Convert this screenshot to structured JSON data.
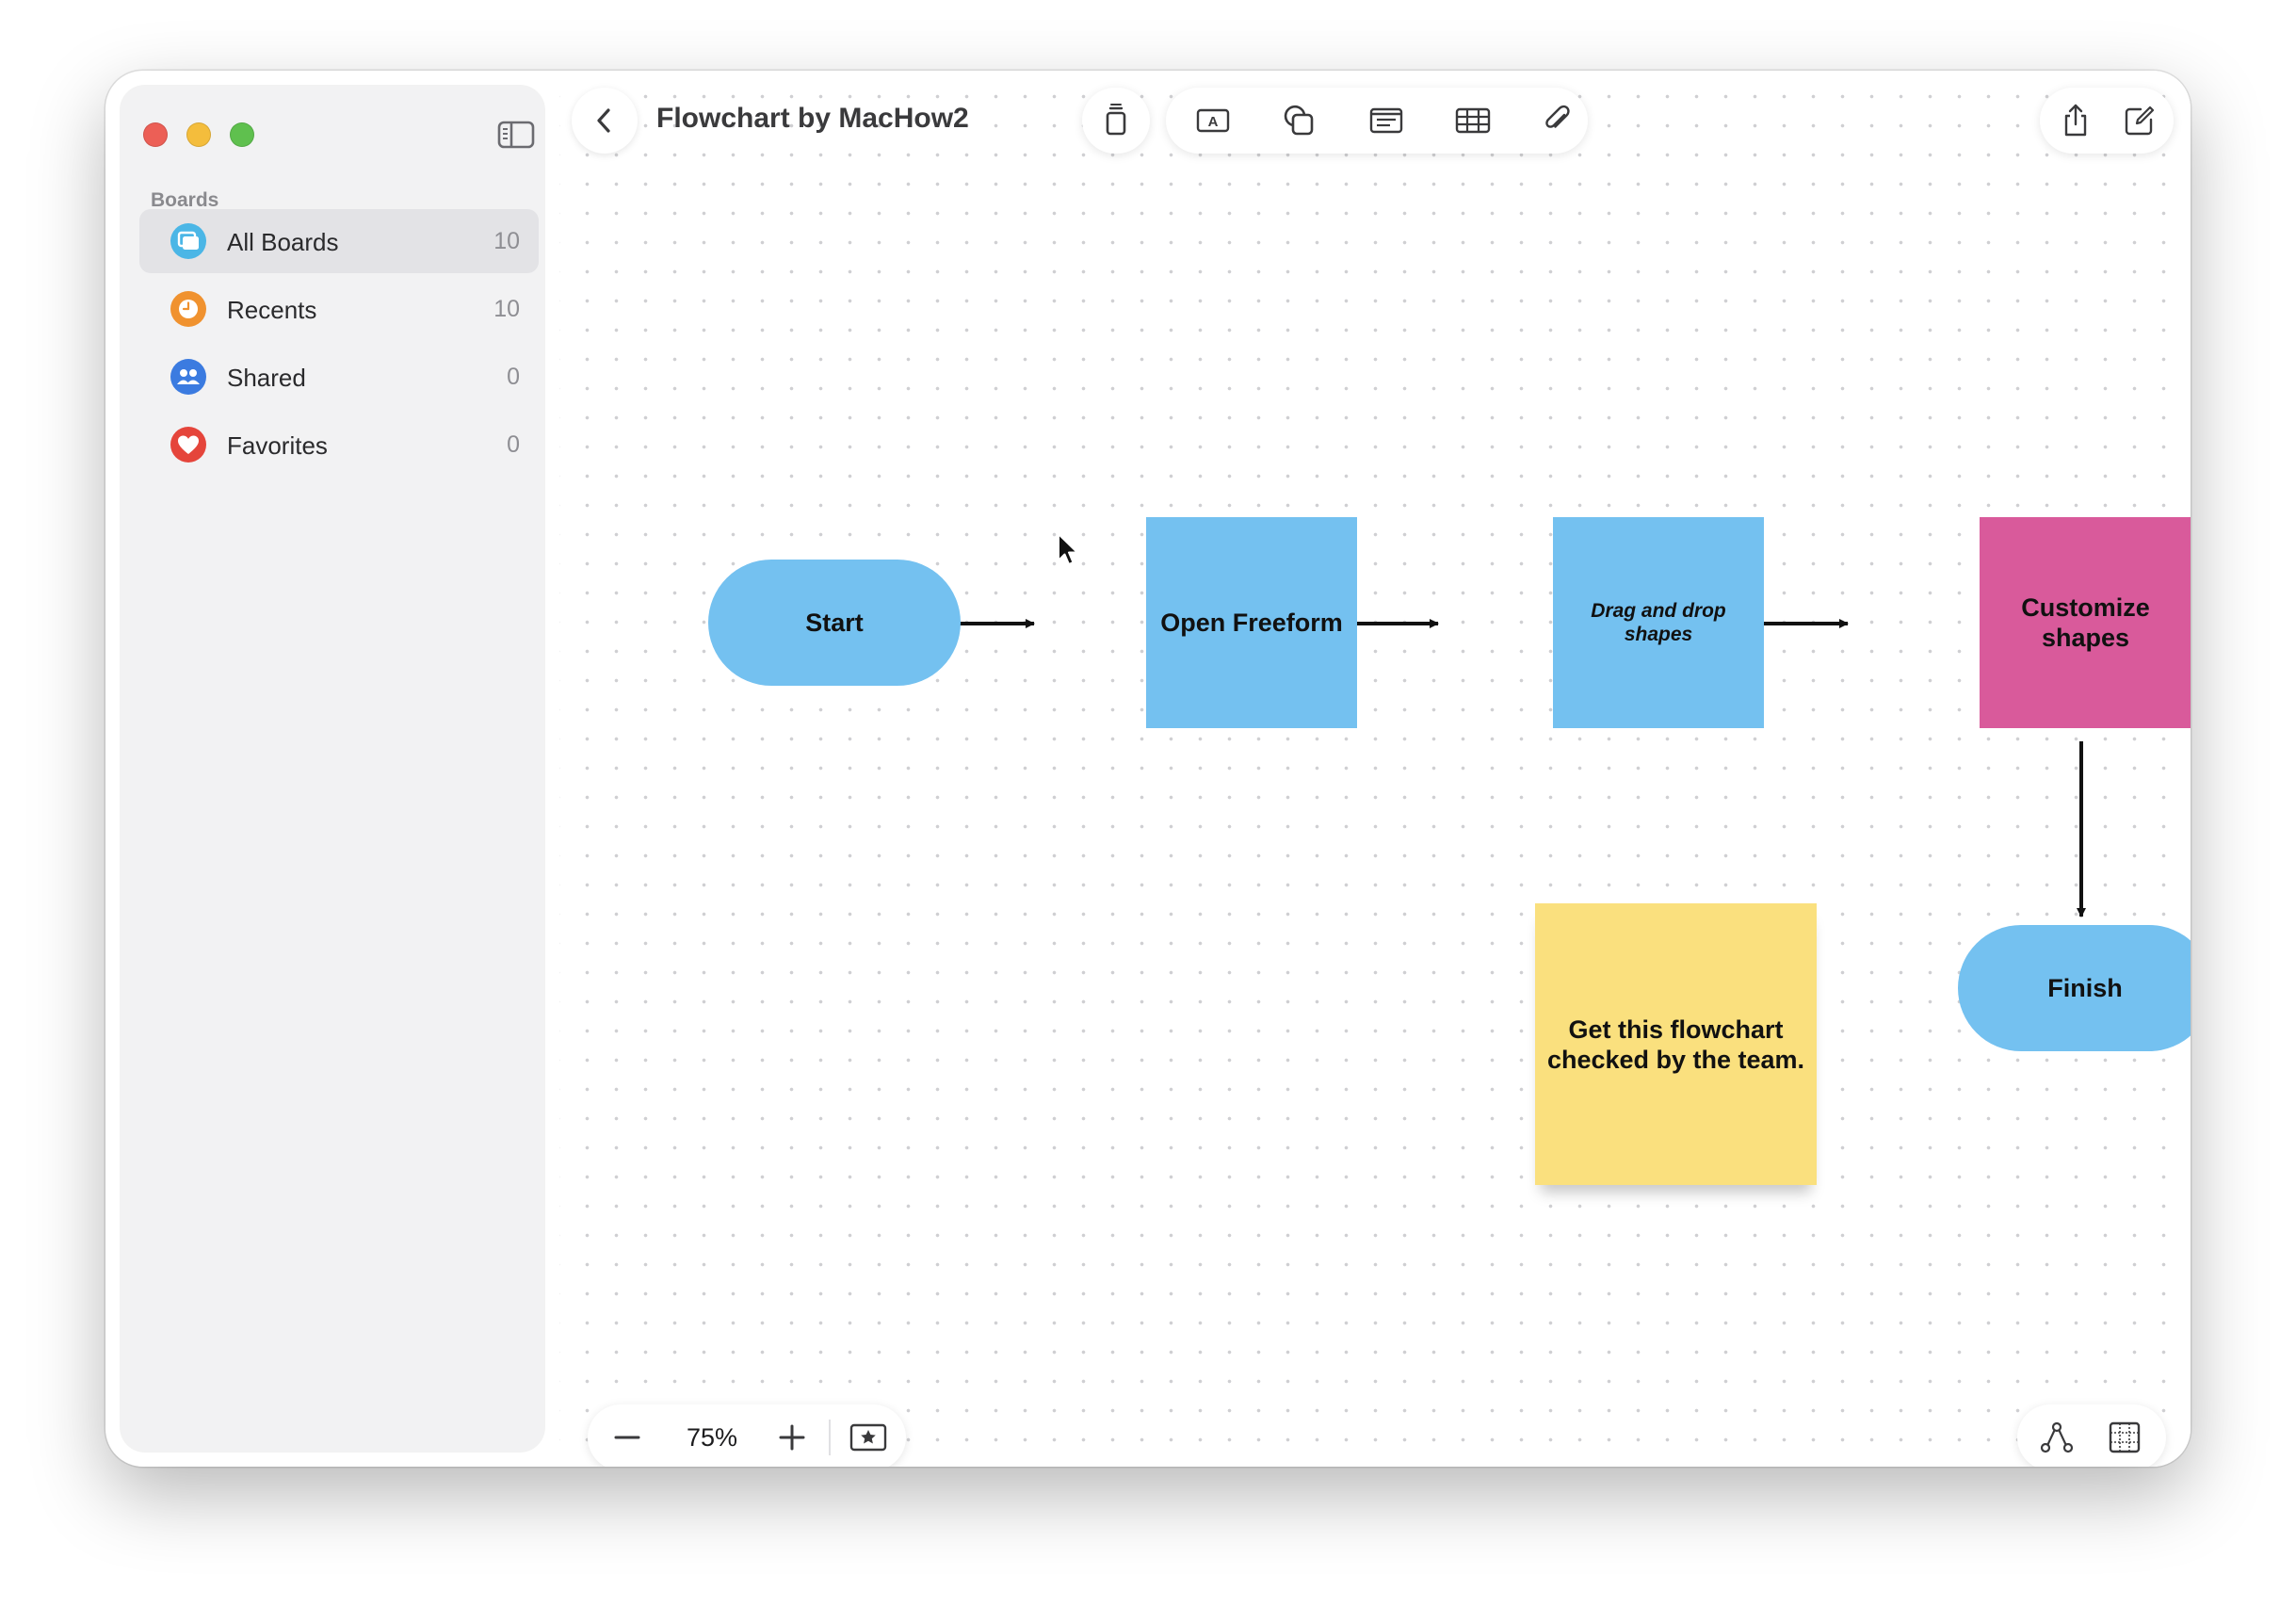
{
  "window": {
    "title": "Flowchart by MacHow2"
  },
  "sidebar": {
    "heading": "Boards",
    "items": [
      {
        "label": "All Boards",
        "count": "10",
        "icon": "all-boards-icon",
        "color": "#4bb6e6",
        "selected": true
      },
      {
        "label": "Recents",
        "count": "10",
        "icon": "clock-icon",
        "color": "#f0922f",
        "selected": false
      },
      {
        "label": "Shared",
        "count": "0",
        "icon": "people-icon",
        "color": "#3b7be0",
        "selected": false
      },
      {
        "label": "Favorites",
        "count": "0",
        "icon": "heart-icon",
        "color": "#e5453b",
        "selected": false
      }
    ]
  },
  "toolbar": {
    "tools": [
      "sticky-note-icon",
      "text-box-icon",
      "shapes-icon",
      "text-icon",
      "table-icon",
      "attachment-icon"
    ],
    "right": [
      "share-icon",
      "new-board-icon"
    ]
  },
  "canvas": {
    "nodes": {
      "start": "Start",
      "open_freeform": "Open Freeform",
      "drag_drop": "Drag and drop shapes",
      "customize": "Customize shapes",
      "finish": "Finish",
      "sticky_note": "Get this flowchart checked by the team."
    },
    "colors": {
      "blue": "#74c1f0",
      "pink": "#d95a9b",
      "yellow": "#fae07e"
    }
  },
  "zoom": {
    "value": "75%"
  },
  "bottom_right": [
    "connection-tool-icon",
    "grid-icon"
  ]
}
